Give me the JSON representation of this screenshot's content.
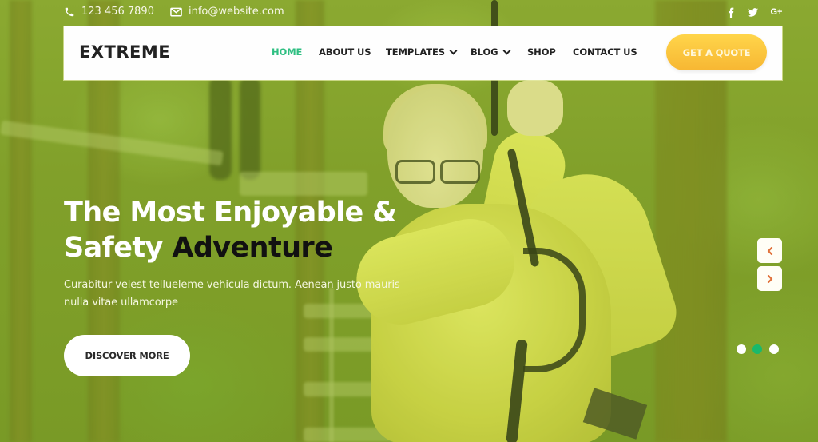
{
  "topbar": {
    "phone": "123 456 7890",
    "email": "info@website.com",
    "social": [
      {
        "name": "facebook",
        "glyph": "f"
      },
      {
        "name": "twitter",
        "glyph": "t"
      },
      {
        "name": "google-plus",
        "glyph": "G+"
      }
    ]
  },
  "nav": {
    "logo": "EXTREME",
    "items": [
      {
        "label": "HOME",
        "active": true,
        "dropdown": false
      },
      {
        "label": "ABOUT US",
        "active": false,
        "dropdown": false
      },
      {
        "label": "TEMPLATES",
        "active": false,
        "dropdown": true
      },
      {
        "label": "BLOG",
        "active": false,
        "dropdown": true
      },
      {
        "label": "SHOP",
        "active": false,
        "dropdown": false
      },
      {
        "label": "CONTACT US",
        "active": false,
        "dropdown": false
      }
    ],
    "cta_label": "GET A QUOTE"
  },
  "hero": {
    "title_line1": "The Most Enjoyable &",
    "title_line2_light": "Safety",
    "title_line2_dark": "Adventure",
    "description": "Curabitur velest tellueleme vehicula dictum. Aenean justo mauris nulla vitae ullamcorpe",
    "button_label": "DISCOVER MORE"
  },
  "slider": {
    "prev_icon": "chevron-left-icon",
    "next_icon": "chevron-right-icon",
    "slide_count": 3,
    "active_slide": 2
  },
  "colors": {
    "accent_green": "#2fbf82",
    "dot_active": "#19b96b",
    "cta_yellow": "#f7b733",
    "arrow_color": "#e0703a",
    "overlay_green": "#8aa836"
  }
}
